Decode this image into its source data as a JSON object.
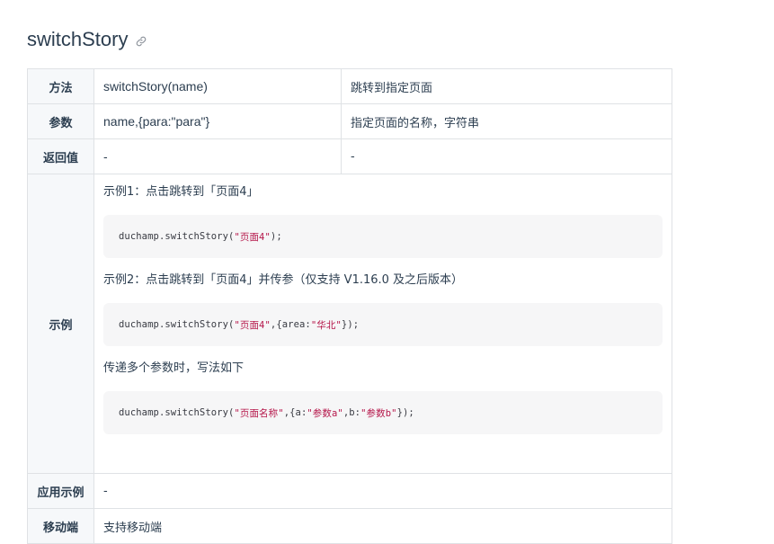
{
  "title": "switchStory",
  "anchor_icon": "link-icon",
  "rows": {
    "method": {
      "key": "方法",
      "value": "switchStory(name)",
      "desc": "跳转到指定页面"
    },
    "params": {
      "key": "参数",
      "value": "name,{para:\"para\"}",
      "desc": "指定页面的名称，字符串"
    },
    "returns": {
      "key": "返回值",
      "value": "-",
      "desc": "-"
    },
    "example": {
      "key": "示例",
      "ex1_text": "示例1：点击跳转到「页面4」",
      "ex1_code_pre": "duchamp.switchStory(",
      "ex1_code_str": "\"页面4\"",
      "ex1_code_post": ");",
      "ex2_text": "示例2：点击跳转到「页面4」并传参（仅支持 V1.16.0 及之后版本）",
      "ex2_code_pre": "duchamp.switchStory(",
      "ex2_code_str1": "\"页面4\"",
      "ex2_code_mid": ",{area:",
      "ex2_code_str2": "\"华北\"",
      "ex2_code_post": "});",
      "ex3_text": "传递多个参数时，写法如下",
      "ex3_code_pre": "duchamp.switchStory(",
      "ex3_code_str1": "\"页面名称\"",
      "ex3_code_mid1": ",{a:",
      "ex3_code_str2": "\"参数a\"",
      "ex3_code_mid2": ",b:",
      "ex3_code_str3": "\"参数b\"",
      "ex3_code_post": "});"
    },
    "usage": {
      "key": "应用示例",
      "value": "-"
    },
    "mobile": {
      "key": "移动端",
      "value": "支持移动端"
    }
  },
  "colors": {
    "text": "#2c3e50",
    "border": "#dfe2e5",
    "key_bg": "#f6f8fa",
    "code_bg": "#f6f6f7",
    "code_string": "#b5164a"
  }
}
